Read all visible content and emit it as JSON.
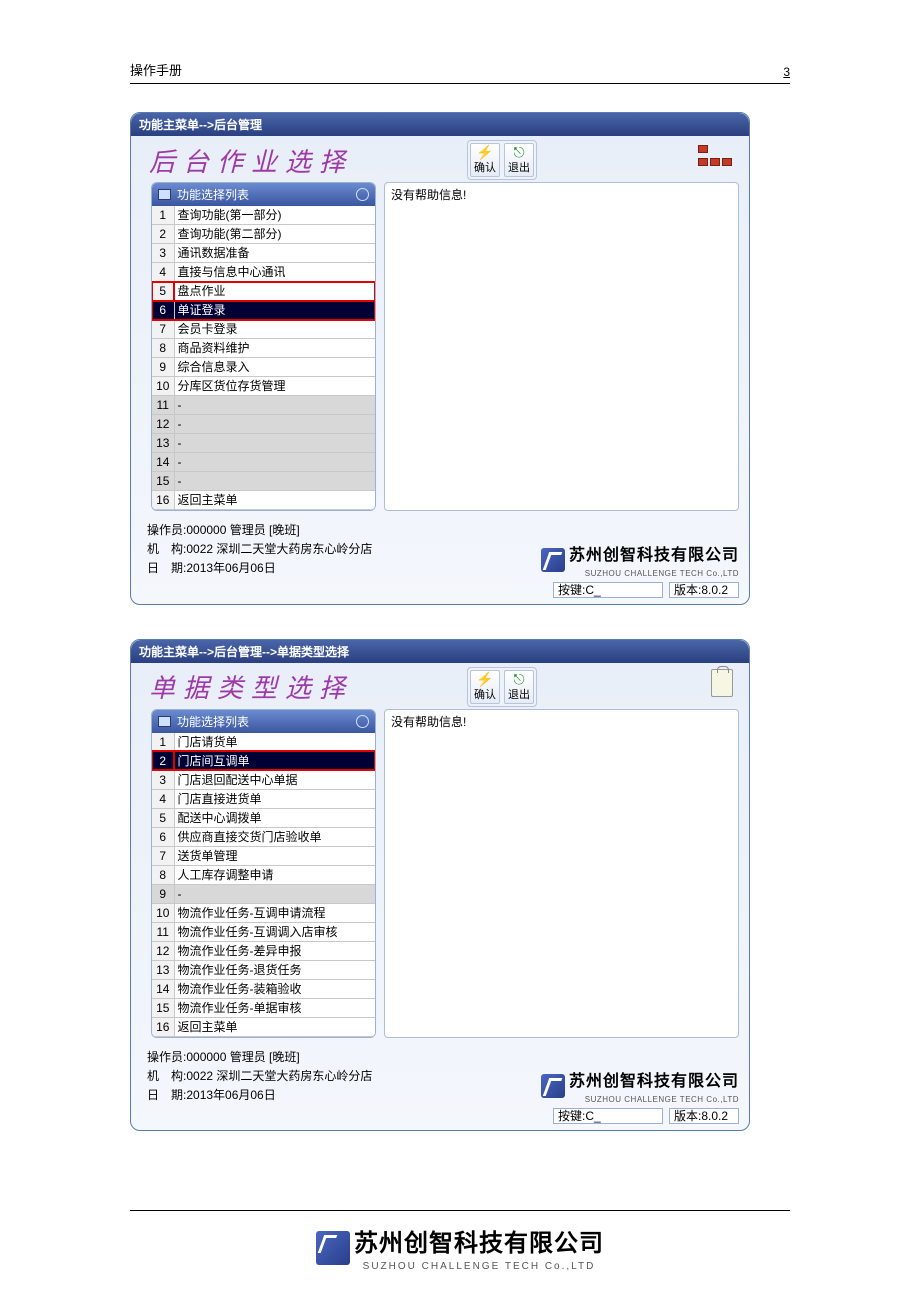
{
  "doc": {
    "title": "操作手册",
    "page_number": "3"
  },
  "window1": {
    "title": "功能主菜单-->后台管理",
    "section": "后台作业选择",
    "btn_confirm": "确认",
    "btn_exit": "退出",
    "list_header": "功能选择列表",
    "help_text": "没有帮助信息!",
    "rows": [
      {
        "n": "1",
        "label": "查询功能(第一部分)"
      },
      {
        "n": "2",
        "label": "查询功能(第二部分)"
      },
      {
        "n": "3",
        "label": "通讯数据准备"
      },
      {
        "n": "4",
        "label": "直接与信息中心通讯"
      },
      {
        "n": "5",
        "label": "盘点作业"
      },
      {
        "n": "6",
        "label": "单证登录"
      },
      {
        "n": "7",
        "label": "会员卡登录"
      },
      {
        "n": "8",
        "label": "商品资料维护"
      },
      {
        "n": "9",
        "label": "综合信息录入"
      },
      {
        "n": "10",
        "label": "分库区货位存货管理"
      },
      {
        "n": "11",
        "label": "-"
      },
      {
        "n": "12",
        "label": "-"
      },
      {
        "n": "13",
        "label": "-"
      },
      {
        "n": "14",
        "label": "-"
      },
      {
        "n": "15",
        "label": "-"
      },
      {
        "n": "16",
        "label": "返回主菜单"
      }
    ],
    "selected_index": 5,
    "red_indices": [
      4,
      5
    ],
    "gray_indices": [
      10,
      11,
      12,
      13,
      14
    ],
    "operator_label": "操作员:",
    "operator": "000000 管理员 [晚班]",
    "org_label": "机　构:",
    "org": "0022 深圳二天堂大药房东心岭分店",
    "date_label": "日　期:",
    "date": "2013年06月06日",
    "key_label": "按键:C_",
    "version_label": "版本:8.0.2"
  },
  "window2": {
    "title": "功能主菜单-->后台管理-->单据类型选择",
    "section": "单据类型选择",
    "btn_confirm": "确认",
    "btn_exit": "退出",
    "list_header": "功能选择列表",
    "help_text": "没有帮助信息!",
    "rows": [
      {
        "n": "1",
        "label": "门店请货单"
      },
      {
        "n": "2",
        "label": "门店间互调单"
      },
      {
        "n": "3",
        "label": "门店退回配送中心单据"
      },
      {
        "n": "4",
        "label": "门店直接进货单"
      },
      {
        "n": "5",
        "label": "配送中心调拨单"
      },
      {
        "n": "6",
        "label": "供应商直接交货门店验收单"
      },
      {
        "n": "7",
        "label": "送货单管理"
      },
      {
        "n": "8",
        "label": "人工库存调整申请"
      },
      {
        "n": "9",
        "label": "-"
      },
      {
        "n": "10",
        "label": "物流作业任务-互调申请流程"
      },
      {
        "n": "11",
        "label": "物流作业任务-互调调入店审核"
      },
      {
        "n": "12",
        "label": "物流作业任务-差异申报"
      },
      {
        "n": "13",
        "label": "物流作业任务-退货任务"
      },
      {
        "n": "14",
        "label": "物流作业任务-装箱验收"
      },
      {
        "n": "15",
        "label": "物流作业任务-单据审核"
      },
      {
        "n": "16",
        "label": "返回主菜单"
      }
    ],
    "selected_index": 1,
    "red_indices": [
      1
    ],
    "gray_indices": [
      8
    ],
    "operator_label": "操作员:",
    "operator": "000000 管理员 [晚班]",
    "org_label": "机　构:",
    "org": "0022 深圳二天堂大药房东心岭分店",
    "date_label": "日　期:",
    "date": "2013年06月06日",
    "key_label": "按键:C_",
    "version_label": "版本:8.0.2"
  },
  "company": {
    "cn": "苏州创智科技有限公司",
    "en": "SUZHOU CHALLENGE TECH Co.,LTD"
  }
}
